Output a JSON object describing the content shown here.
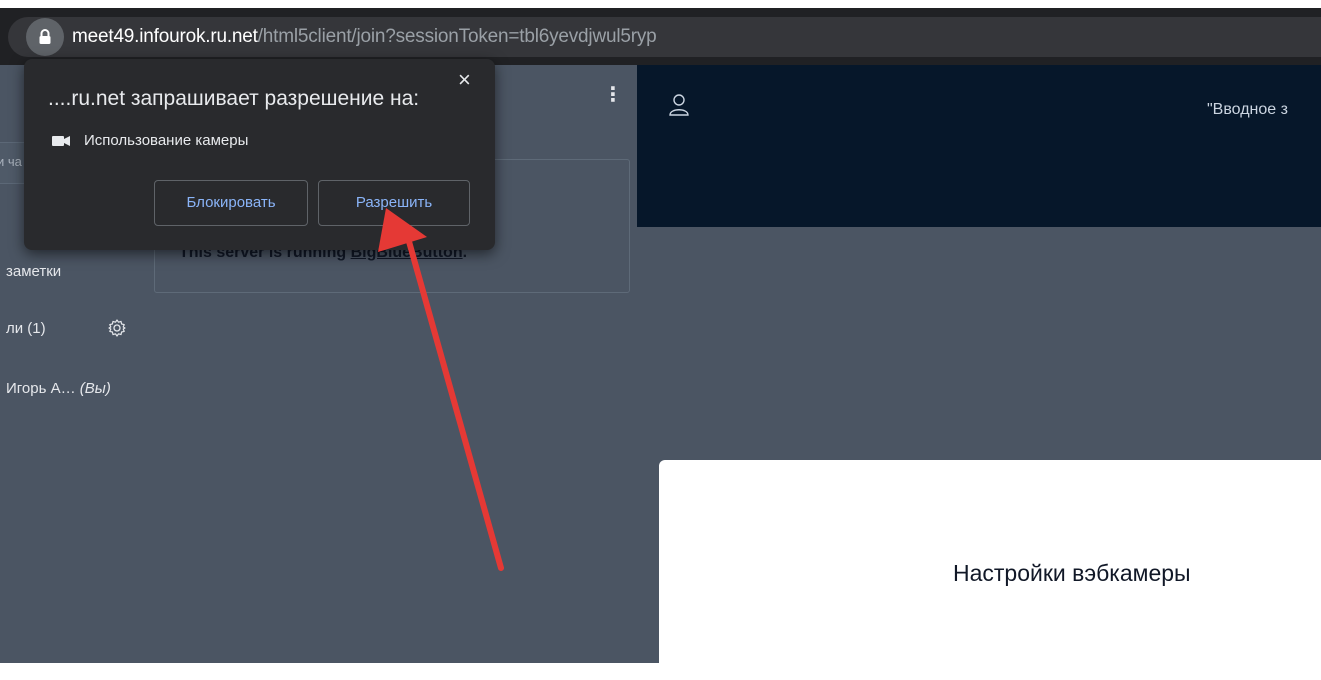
{
  "browser": {
    "url_host": "meet49.infourok.ru.net",
    "url_path": "/html5client/join?sessionToken=tbl6yevdjwul5ryp"
  },
  "permission_popup": {
    "title": "....ru.net запрашивает разрешение на:",
    "close_label": "×",
    "permission_label": "Использование камеры",
    "block_label": "Блокировать",
    "allow_label": "Разрешить"
  },
  "sidebar": {
    "chat_fragment": "и ча",
    "notes_label": "заметки",
    "users_label": "ли (1)",
    "me_name": "Игорь А…",
    "me_suffix": "(Вы)"
  },
  "chat_panel": {
    "menu_label": "⋮",
    "welcome_prefix": "This server is running ",
    "welcome_link": "BigBlueButton",
    "welcome_suffix": "."
  },
  "header": {
    "meeting_title": "\"Вводное з"
  },
  "modal": {
    "title": "Настройки вэбкамеры"
  },
  "colors": {
    "accent_arrow": "#e53935",
    "popup_button_text": "#8ab4f8",
    "header_bg": "#06172a"
  }
}
